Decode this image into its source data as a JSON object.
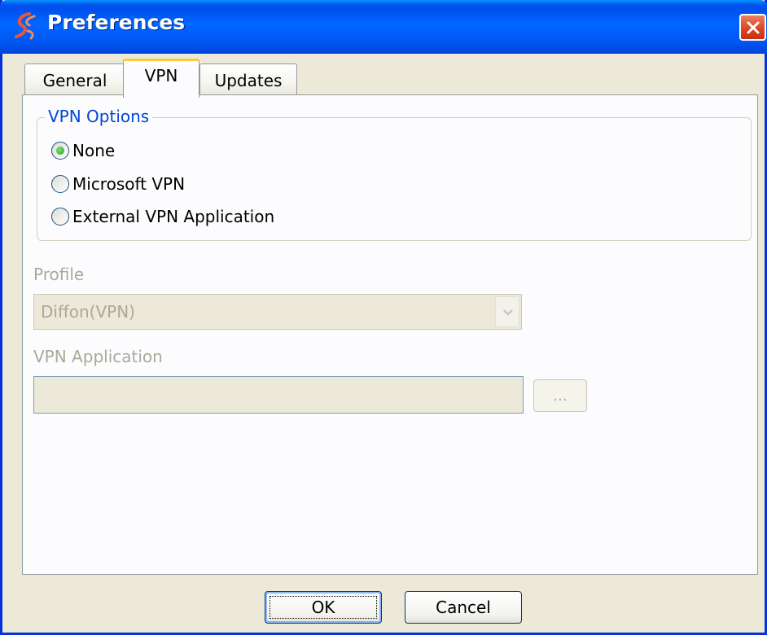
{
  "window": {
    "title": "Preferences"
  },
  "colors": {
    "title_bar": "#0058f4",
    "close_button": "#e04424",
    "group_title": "#0046d5",
    "disabled_text": "#aca899",
    "active_tab_highlight": "#ffc83c",
    "selected_radio": "#21a121"
  },
  "icons": {
    "app": "app-logo-icon",
    "close": "close-icon",
    "dropdown": "chevron-down-icon"
  },
  "tabs": [
    {
      "label": "General",
      "active": false
    },
    {
      "label": "VPN",
      "active": true
    },
    {
      "label": "Updates",
      "active": false
    }
  ],
  "vpn_options": {
    "title": "VPN Options",
    "options": [
      {
        "label": "None",
        "selected": true
      },
      {
        "label": "Microsoft VPN",
        "selected": false
      },
      {
        "label": "External VPN Application",
        "selected": false
      }
    ]
  },
  "profile": {
    "label": "Profile",
    "selected_value": "Diffon(VPN)",
    "enabled": false
  },
  "vpn_application": {
    "label": "VPN Application",
    "value": "",
    "browse_label": "...",
    "enabled": false
  },
  "footer": {
    "ok_label": "OK",
    "cancel_label": "Cancel"
  }
}
